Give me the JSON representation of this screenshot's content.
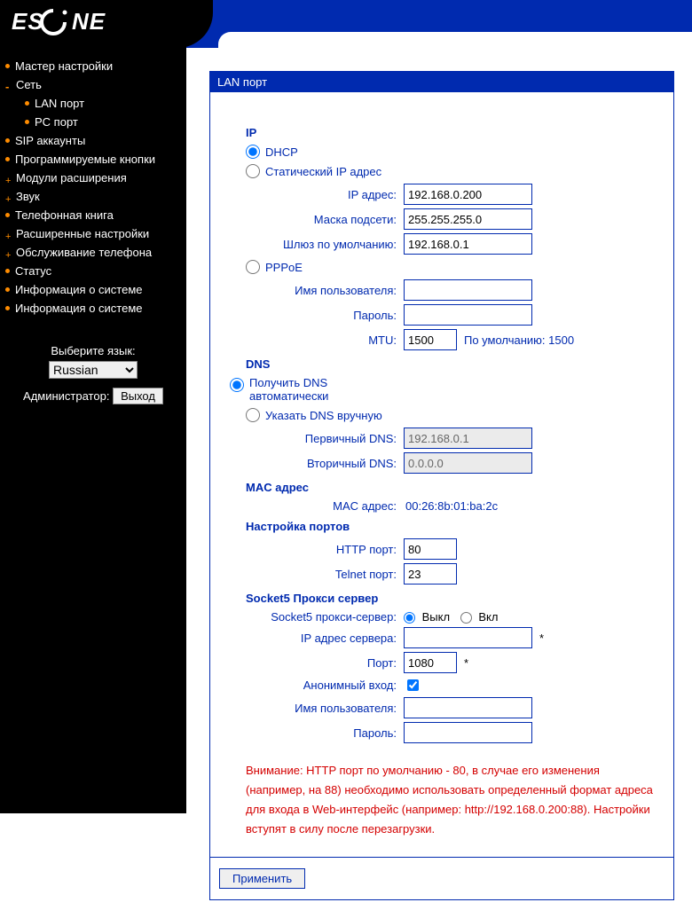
{
  "brand": "ESCENE",
  "sidebar": {
    "items": [
      {
        "label": "Мастер настройки",
        "bullet": "dot",
        "name": "nav-setup-wizard"
      },
      {
        "label": "Сеть",
        "bullet": "minus",
        "name": "nav-network",
        "children": [
          {
            "label": "LAN порт",
            "name": "nav-lan-port"
          },
          {
            "label": "PC порт",
            "name": "nav-pc-port"
          }
        ]
      },
      {
        "label": "SIP аккаунты",
        "bullet": "dot",
        "name": "nav-sip-accounts"
      },
      {
        "label": "Программируемые кнопки",
        "bullet": "dot",
        "name": "nav-prog-keys"
      },
      {
        "label": "Модули расширения",
        "bullet": "plus",
        "name": "nav-ext-modules"
      },
      {
        "label": "Звук",
        "bullet": "plus",
        "name": "nav-sound"
      },
      {
        "label": "Телефонная книга",
        "bullet": "dot",
        "name": "nav-phonebook"
      },
      {
        "label": "Расширенные настройки",
        "bullet": "plus",
        "name": "nav-advanced"
      },
      {
        "label": "Обслуживание телефона",
        "bullet": "plus",
        "name": "nav-maintenance"
      },
      {
        "label": "Статус",
        "bullet": "dot",
        "name": "nav-status"
      },
      {
        "label": "Информация о системе",
        "bullet": "dot",
        "name": "nav-sysinfo-1"
      },
      {
        "label": "Информация о системе",
        "bullet": "dot",
        "name": "nav-sysinfo-2"
      }
    ],
    "lang_label": "Выберите язык:",
    "lang_value": "Russian",
    "admin_label": "Администратор:",
    "logout_label": "Выход"
  },
  "panel": {
    "title": "LAN порт",
    "ip": {
      "heading": "IP",
      "dhcp_label": "DHCP",
      "static_label": "Статический IP адрес",
      "ip_label": "IP адрес:",
      "ip_value": "192.168.0.200",
      "mask_label": "Маска подсети:",
      "mask_value": "255.255.255.0",
      "gateway_label": "Шлюз по умолчанию:",
      "gateway_value": "192.168.0.1",
      "pppoe_label": "PPPoE",
      "user_label": "Имя пользователя:",
      "user_value": "",
      "pass_label": "Пароль:",
      "pass_value": "",
      "mtu_label": "MTU:",
      "mtu_value": "1500",
      "mtu_suffix": "По умолчанию: 1500"
    },
    "dns": {
      "heading": "DNS",
      "auto_label": "Получить DNS автоматически",
      "manual_label": "Указать DNS вручную",
      "primary_label": "Первичный DNS:",
      "primary_value": "192.168.0.1",
      "secondary_label": "Вторичный DNS:",
      "secondary_value": "0.0.0.0"
    },
    "mac": {
      "heading": "MAC адрес",
      "label": "MAC адрес:",
      "value": "00:26:8b:01:ba:2c"
    },
    "ports": {
      "heading": "Настройка портов",
      "http_label": "HTTP порт:",
      "http_value": "80",
      "telnet_label": "Telnet порт:",
      "telnet_value": "23"
    },
    "socks": {
      "heading": "Socket5 Прокси сервер",
      "proxy_label": "Socket5 прокси-сервер:",
      "off_label": "Выкл",
      "on_label": "Вкл",
      "server_ip_label": "IP адрес сервера:",
      "server_ip_value": "",
      "port_label": "Порт:",
      "port_value": "1080",
      "anon_label": "Анонимный вход:",
      "user_label": "Имя пользователя:",
      "user_value": "",
      "pass_label": "Пароль:",
      "pass_value": ""
    },
    "warning": "Внимание: HTTP порт по умолчанию - 80, в случае его изменения (например, на 88) необходимо использовать определенный формат адреса для входа в Web-интерфейс (например: http://192.168.0.200:88). Настройки вступят в силу после перезагрузки.",
    "apply_label": "Применить"
  }
}
